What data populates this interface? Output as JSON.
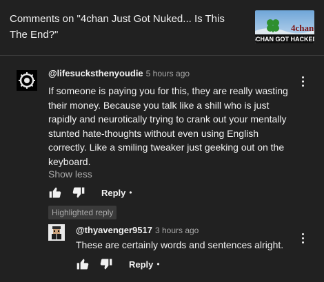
{
  "header": {
    "title": "Comments on \"4chan Just Got Nuked... Is This The End?\"",
    "thumbnail": {
      "logo_text": "4chan",
      "caption": "4CHAN GOT HACKED",
      "icon": "clover-icon",
      "accent": "#2a8a2a"
    }
  },
  "comment": {
    "author": "@lifesucksthenyoudie",
    "time": "5 hours ago",
    "text": "If someone is paying you for this, they are really wasting their money. Because you talk like a shill who is just rapidly and neurotically trying to crank out your mentally stunted hate-thoughts without even using English correctly. Like a smiling tweaker just geeking out on the keyboard.",
    "show_less": "Show less",
    "reply_label": "Reply",
    "dot": "•"
  },
  "highlighted_label": "Highlighted reply",
  "reply": {
    "author": "@thyavenger9517",
    "time": "3 hours ago",
    "text": "These are certainly words and sentences alright.",
    "reply_label": "Reply",
    "dot": "•"
  },
  "icons": {
    "like": "thumbs-up-icon",
    "dislike": "thumbs-down-icon",
    "menu": "more-vertical-icon"
  }
}
